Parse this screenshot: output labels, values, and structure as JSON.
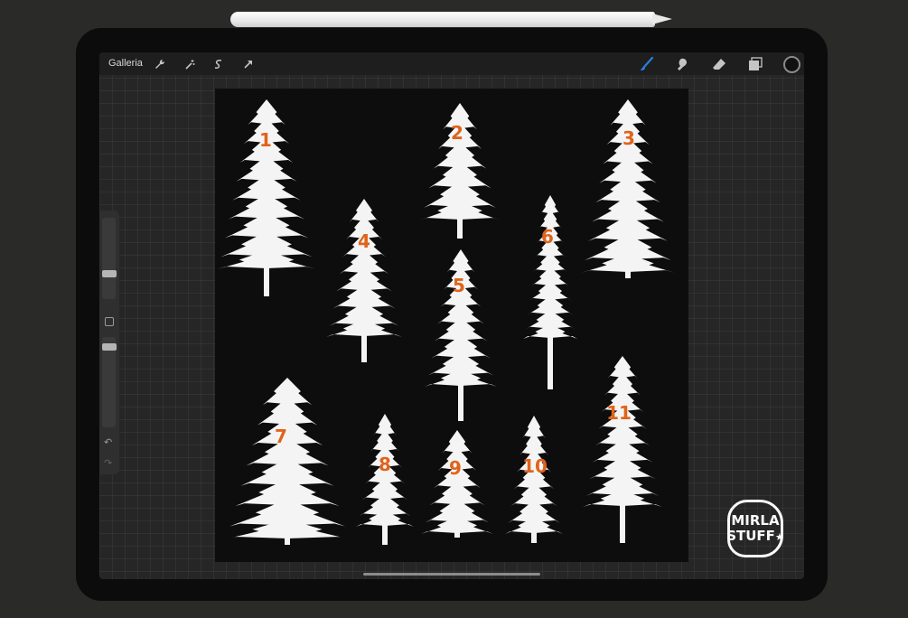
{
  "toolbar": {
    "gallery_label": "Galleria",
    "left_icons": [
      "wrench-icon",
      "magic-wand-icon",
      "selection-icon",
      "transform-arrow-icon"
    ],
    "right_icons": [
      "brush-icon",
      "smudge-icon",
      "eraser-icon",
      "layers-icon"
    ],
    "active_tool": "brush-icon",
    "accent": "#2a7de1",
    "current_color": "#111111"
  },
  "sidebar": {
    "undo_glyph": "↶",
    "redo_glyph": "↷"
  },
  "trees": [
    {
      "label": "1"
    },
    {
      "label": "2"
    },
    {
      "label": "3"
    },
    {
      "label": "4"
    },
    {
      "label": "5"
    },
    {
      "label": "6"
    },
    {
      "label": "7"
    },
    {
      "label": "8"
    },
    {
      "label": "9"
    },
    {
      "label": "10"
    },
    {
      "label": "11"
    }
  ],
  "logo": {
    "line1": "MIRLA",
    "line2": "STUFF",
    "mark": "★"
  },
  "colors": {
    "number_color": "#e0631a",
    "tree_color": "#f4f4f4",
    "canvas": "#0d0d0d"
  }
}
